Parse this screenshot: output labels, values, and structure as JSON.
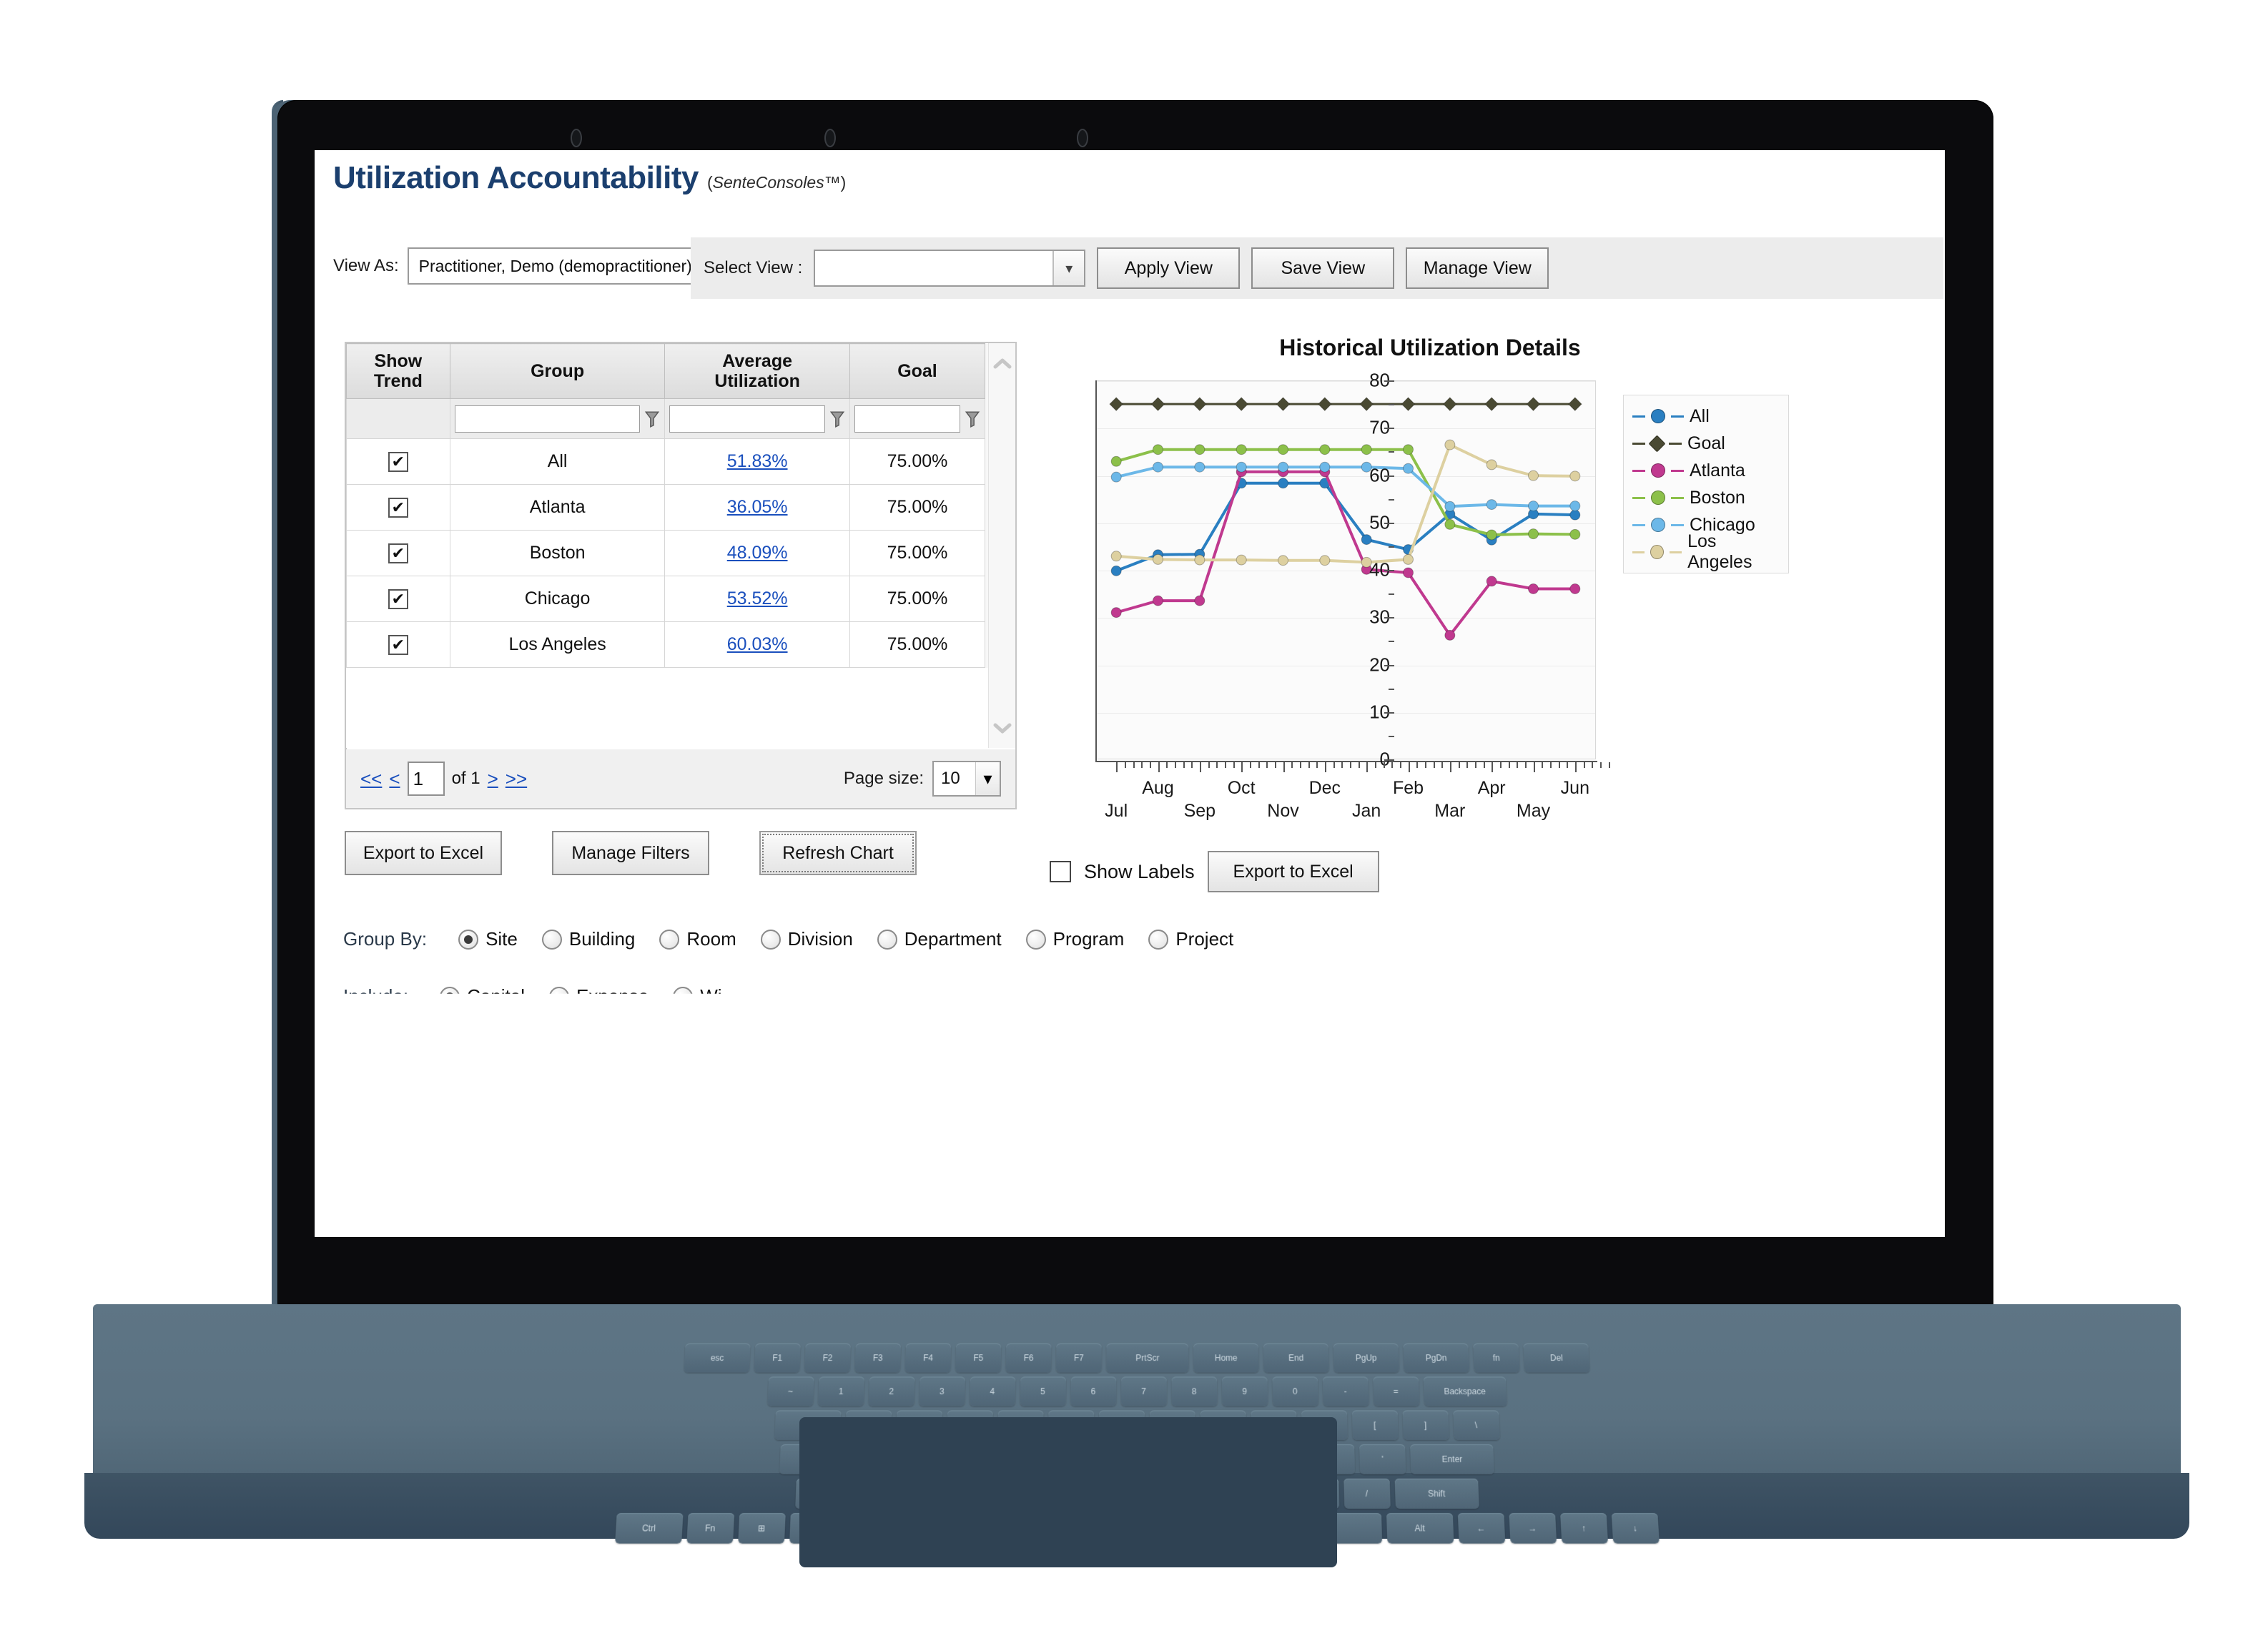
{
  "app": {
    "title": "Utilization Accountability",
    "subtitle_prefix": "(",
    "subtitle_brand_1": "Sente",
    "subtitle_brand_2": "Consoles",
    "subtitle_suffix": "™)"
  },
  "toolbar": {
    "view_as_label": "View As:",
    "view_as_value": "Practitioner, Demo (demopractitioner)",
    "select_view_label": "Select View :",
    "select_view_value": "",
    "apply_view": "Apply View",
    "save_view": "Save View",
    "manage_view": "Manage View"
  },
  "grid": {
    "columns": [
      "Show Trend",
      "Group",
      "Average Utilization",
      "Goal"
    ],
    "column_show_trend_line1": "Show",
    "column_show_trend_line2": "Trend",
    "column_group": "Group",
    "column_avg_line1": "Average",
    "column_avg_line2": "Utilization",
    "column_goal": "Goal",
    "filters": {
      "group": "",
      "average_utilization": "",
      "goal": ""
    },
    "rows": [
      {
        "show_trend": true,
        "group": "All",
        "average_utilization": "51.83%",
        "goal": "75.00%"
      },
      {
        "show_trend": true,
        "group": "Atlanta",
        "average_utilization": "36.05%",
        "goal": "75.00%"
      },
      {
        "show_trend": true,
        "group": "Boston",
        "average_utilization": "48.09%",
        "goal": "75.00%"
      },
      {
        "show_trend": true,
        "group": "Chicago",
        "average_utilization": "53.52%",
        "goal": "75.00%"
      },
      {
        "show_trend": true,
        "group": "Los Angeles",
        "average_utilization": "60.03%",
        "goal": "75.00%"
      }
    ],
    "checkbox_glyph": "✔"
  },
  "pager": {
    "first": "<<",
    "prev": "<",
    "page_value": "1",
    "of_text": "of 1",
    "next": ">",
    "last": ">>",
    "page_size_label": "Page size:",
    "page_size_value": "10"
  },
  "grid_buttons": {
    "export_to_excel": "Export to Excel",
    "manage_filters": "Manage Filters",
    "refresh_chart": "Refresh Chart"
  },
  "chart_foot": {
    "show_labels_label": "Show Labels",
    "show_labels_checked": false,
    "export_to_excel": "Export to Excel"
  },
  "group_by": {
    "label": "Group By:",
    "options": [
      "Site",
      "Building",
      "Room",
      "Division",
      "Department",
      "Program",
      "Project"
    ],
    "selected": "Site"
  },
  "include_row": {
    "label": "Include:",
    "options": [
      "Capital",
      "Expense",
      "Wi"
    ],
    "selected": "Capital"
  },
  "colors": {
    "title_blue": "#1b3f6e",
    "link_blue": "#1a4fbd",
    "all": "#2a7fc1",
    "goal": "#4a4a33",
    "atlanta": "#c0398f",
    "boston": "#8cc04a",
    "chicago": "#6cb8e8",
    "los_angeles": "#ddd0a0"
  },
  "chart_data": {
    "type": "line",
    "title": "Historical Utilization Details",
    "xlabel": "",
    "ylabel": "",
    "x": [
      "Jul",
      "Aug",
      "Sep",
      "Oct",
      "Nov",
      "Dec",
      "Jan",
      "Feb",
      "Mar",
      "Apr",
      "May",
      "Jun"
    ],
    "xtick_labels": [
      "Jul",
      "Aug",
      "Sep",
      "Oct",
      "Nov",
      "Dec",
      "Jan",
      "Feb",
      "Mar",
      "Apr",
      "May",
      "Jun"
    ],
    "ytick_labels": [
      "0",
      "10",
      "20",
      "30",
      "40",
      "50",
      "60",
      "70",
      "80"
    ],
    "ylim": [
      0,
      80
    ],
    "grid": true,
    "legend_position": "right",
    "series": [
      {
        "name": "All",
        "color": "#2a7fc1",
        "marker": "circle",
        "values": [
          39.8,
          43.2,
          43.3,
          58.3,
          58.3,
          58.3,
          46.4,
          44.3,
          51.8,
          46.3,
          51.8,
          51.6
        ]
      },
      {
        "name": "Goal",
        "color": "#4a4a33",
        "marker": "diamond",
        "values": [
          75,
          75,
          75,
          75,
          75,
          75,
          75,
          75,
          75,
          75,
          75,
          75
        ]
      },
      {
        "name": "Atlanta",
        "color": "#c0398f",
        "marker": "circle",
        "values": [
          31.0,
          33.5,
          33.5,
          60.7,
          60.7,
          60.7,
          40.1,
          39.4,
          26.2,
          37.6,
          36.0,
          36.0
        ]
      },
      {
        "name": "Boston",
        "color": "#8cc04a",
        "marker": "circle",
        "values": [
          62.9,
          65.4,
          65.4,
          65.4,
          65.4,
          65.4,
          65.4,
          65.4,
          49.6,
          47.4,
          47.6,
          47.5
        ]
      },
      {
        "name": "Chicago",
        "color": "#6cb8e8",
        "marker": "circle",
        "values": [
          59.6,
          61.7,
          61.7,
          61.7,
          61.7,
          61.7,
          61.7,
          61.4,
          53.4,
          53.8,
          53.5,
          53.5
        ]
      },
      {
        "name": "Los Angeles",
        "color": "#ddd0a0",
        "marker": "circle",
        "values": [
          42.9,
          42.2,
          42.1,
          42.1,
          42.0,
          42.0,
          41.6,
          42.2,
          66.4,
          62.2,
          59.9,
          59.8
        ]
      }
    ]
  }
}
